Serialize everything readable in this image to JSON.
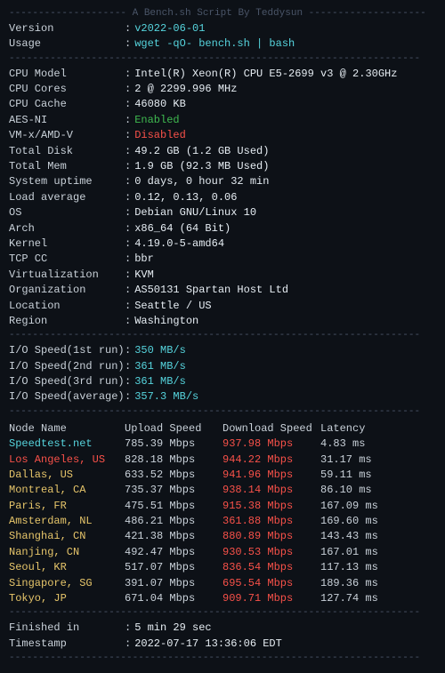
{
  "header": {
    "divider_top": "-------------------- A Bench.sh Script By Teddysun --------------------",
    "divider_line": "----------------------------------------------------------------------"
  },
  "system": {
    "version_label": "Version",
    "version_value": "v2022-06-01",
    "usage_label": "Usage",
    "usage_value": "wget -qO- bench.sh | bash"
  },
  "cpu": {
    "model_label": "CPU Model",
    "model_value": "Intel(R) Xeon(R) CPU E5-2699 v3 @ 2.30GHz",
    "cores_label": "CPU Cores",
    "cores_value": "2 @ 2299.996 MHz",
    "cache_label": "CPU Cache",
    "cache_value": "46080 KB",
    "aes_label": "AES-NI",
    "aes_value": "Enabled",
    "vm_label": "VM-x/AMD-V",
    "vm_value": "Disabled"
  },
  "storage": {
    "disk_label": "Total Disk",
    "disk_value": "49.2 GB (1.2 GB Used)",
    "mem_label": "Total Mem",
    "mem_value": "1.9 GB (92.3 MB Used)"
  },
  "info": {
    "uptime_label": "System uptime",
    "uptime_value": "0 days, 0 hour 32 min",
    "load_label": "Load average",
    "load_value": "0.12, 0.13, 0.06",
    "os_label": "OS",
    "os_value": "Debian GNU/Linux 10",
    "arch_label": "Arch",
    "arch_value": "x86_64 (64 Bit)",
    "kernel_label": "Kernel",
    "kernel_value": "4.19.0-5-amd64",
    "tcp_label": "TCP CC",
    "tcp_value": "bbr",
    "virt_label": "Virtualization",
    "virt_value": "KVM",
    "org_label": "Organization",
    "org_value": "AS50131 Spartan Host Ltd",
    "location_label": "Location",
    "location_value": "Seattle / US",
    "region_label": "Region",
    "region_value": "Washington"
  },
  "io": {
    "run1_label": "I/O Speed(1st run)",
    "run1_value": "350 MB/s",
    "run2_label": "I/O Speed(2nd run)",
    "run2_value": "361 MB/s",
    "run3_label": "I/O Speed(3rd run)",
    "run3_value": "361 MB/s",
    "avg_label": "I/O Speed(average)",
    "avg_value": "357.3 MB/s"
  },
  "table": {
    "col_node": "Node Name",
    "col_upload": "Upload Speed",
    "col_download": "Download Speed",
    "col_latency": "Latency",
    "rows": [
      {
        "node": "Speedtest.net",
        "upload": "785.39 Mbps",
        "download": "937.98 Mbps",
        "latency": "4.83 ms",
        "color": "cyan"
      },
      {
        "node": "Los Angeles, US",
        "upload": "828.18 Mbps",
        "download": "944.22 Mbps",
        "latency": "31.17 ms",
        "color": "red"
      },
      {
        "node": "Dallas, US",
        "upload": "633.52 Mbps",
        "download": "941.96 Mbps",
        "latency": "59.11 ms",
        "color": "yellow"
      },
      {
        "node": "Montreal, CA",
        "upload": "735.37 Mbps",
        "download": "938.14 Mbps",
        "latency": "86.10 ms",
        "color": "yellow"
      },
      {
        "node": "Paris, FR",
        "upload": "475.51 Mbps",
        "download": "915.38 Mbps",
        "latency": "167.09 ms",
        "color": "yellow"
      },
      {
        "node": "Amsterdam, NL",
        "upload": "486.21 Mbps",
        "download": "361.88 Mbps",
        "latency": "169.60 ms",
        "color": "yellow"
      },
      {
        "node": "Shanghai, CN",
        "upload": "421.38 Mbps",
        "download": "880.89 Mbps",
        "latency": "143.43 ms",
        "color": "yellow"
      },
      {
        "node": "Nanjing, CN",
        "upload": "492.47 Mbps",
        "download": "930.53 Mbps",
        "latency": "167.01 ms",
        "color": "yellow"
      },
      {
        "node": "Seoul, KR",
        "upload": "517.07 Mbps",
        "download": "836.54 Mbps",
        "latency": "117.13 ms",
        "color": "yellow"
      },
      {
        "node": "Singapore, SG",
        "upload": "391.07 Mbps",
        "download": "695.54 Mbps",
        "latency": "189.36 ms",
        "color": "yellow"
      },
      {
        "node": "Tokyo, JP",
        "upload": "671.04 Mbps",
        "download": "909.71 Mbps",
        "latency": "127.74 ms",
        "color": "yellow"
      }
    ]
  },
  "footer": {
    "finished_label": "Finished in",
    "finished_value": "5 min 29 sec",
    "timestamp_label": "Timestamp",
    "timestamp_value": "2022-07-17 13:36:06 EDT"
  }
}
